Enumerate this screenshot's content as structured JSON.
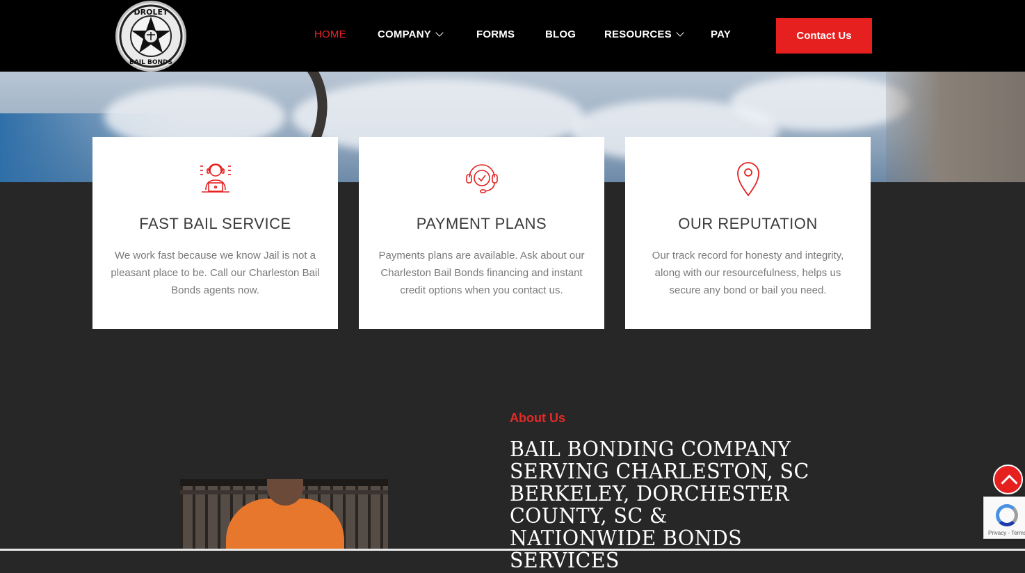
{
  "header": {
    "logo_alt": "Drolet Bail Bonds",
    "nav": [
      {
        "label": "HOME",
        "active": true,
        "dropdown": false
      },
      {
        "label": "COMPANY",
        "active": false,
        "dropdown": true
      },
      {
        "label": "FORMS",
        "active": false,
        "dropdown": false
      },
      {
        "label": "BLOG",
        "active": false,
        "dropdown": false
      },
      {
        "label": "RESOURCES",
        "active": false,
        "dropdown": true
      },
      {
        "label": "PAY",
        "active": false,
        "dropdown": false
      }
    ],
    "contact_label": "Contact Us"
  },
  "features": [
    {
      "icon": "agent-headset-laptop-icon",
      "title": "FAST BAIL SERVICE",
      "desc": "We work fast because we know Jail is not a pleasant place to be. Call our Charleston Bail Bonds agents now."
    },
    {
      "icon": "headset-clock-icon",
      "title": "PAYMENT PLANS",
      "desc": "Payments plans are available. Ask about our Charleston Bail Bonds financing and instant credit options when you contact us."
    },
    {
      "icon": "map-pin-icon",
      "title": "OUR REPUTATION",
      "desc": "Our track record for honesty and integrity, along with our resourcefulness, helps us secure any bond or bail you need."
    }
  ],
  "about": {
    "label": "About Us",
    "heading": "BAIL BONDING COMPANY SERVING CHARLESTON, SC BERKELEY, DORCHESTER COUNTY, SC & NATIONWIDE BONDS SERVICES"
  },
  "recaptcha": {
    "text": "Privacy - Terms"
  },
  "colors": {
    "accent": "#e5201f",
    "header_bg": "#000000",
    "page_bg": "#282727"
  }
}
